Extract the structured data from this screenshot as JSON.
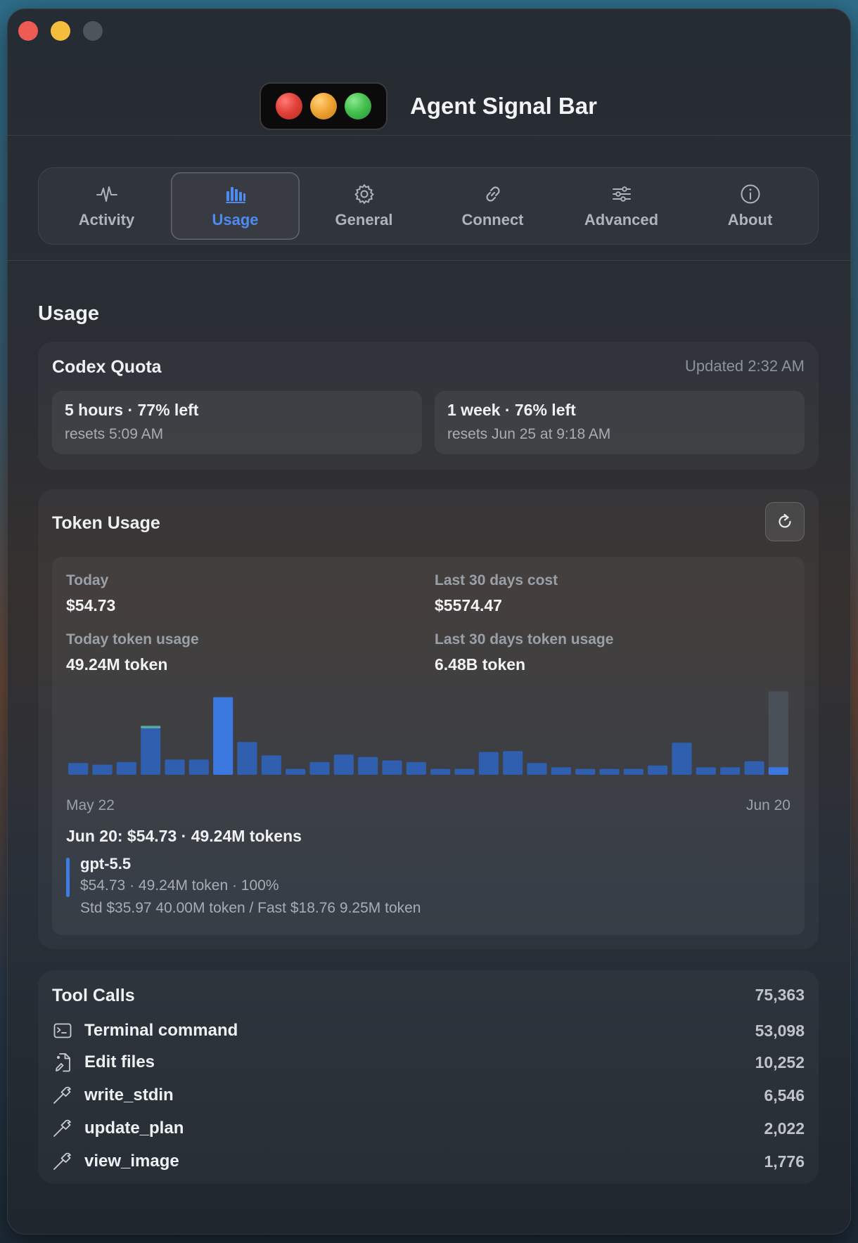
{
  "app": {
    "title": "Agent Signal Bar"
  },
  "tabs": [
    {
      "label": "Activity",
      "icon": "waveform-icon"
    },
    {
      "label": "Usage",
      "icon": "bar-chart-icon",
      "active": true
    },
    {
      "label": "General",
      "icon": "gear-icon"
    },
    {
      "label": "Connect",
      "icon": "link-icon"
    },
    {
      "label": "Advanced",
      "icon": "sliders-icon"
    },
    {
      "label": "About",
      "icon": "info-icon"
    }
  ],
  "page": {
    "title": "Usage"
  },
  "quota": {
    "title": "Codex Quota",
    "updated": "Updated 2:32 AM",
    "windows": [
      {
        "title": "5 hours · 77% left",
        "reset": "resets 5:09 AM"
      },
      {
        "title": "1 week · 76% left",
        "reset": "resets Jun 25 at 9:18 AM"
      }
    ]
  },
  "token_usage": {
    "title": "Token Usage",
    "stats": {
      "today_label": "Today",
      "today_value": "$54.73",
      "cost30_label": "Last 30 days cost",
      "cost30_value": "$5574.47",
      "today_tokens_label": "Today token usage",
      "today_tokens_value": "49.24M token",
      "tokens30_label": "Last 30 days token usage",
      "tokens30_value": "6.48B token"
    },
    "day_summary": "Jun 20: $54.73 · 49.24M tokens",
    "model": {
      "name": "gpt-5.5",
      "line1": "$54.73 · 49.24M token · 100%",
      "line2": "Std $35.97 40.00M token / Fast $18.76 9.25M token"
    }
  },
  "chart_data": {
    "type": "bar",
    "x_start_label": "May 22",
    "x_end_label": "Jun 20",
    "values": [
      14,
      12,
      15,
      55,
      18,
      18,
      92,
      39,
      23,
      7,
      15,
      24,
      21,
      17,
      15,
      7,
      7,
      27,
      28,
      14,
      9,
      7,
      7,
      7,
      11,
      38,
      9,
      9,
      16,
      9
    ],
    "accent_values": [
      0,
      0,
      0,
      3,
      0,
      0,
      0,
      0,
      0,
      0,
      0,
      0,
      0,
      0,
      0,
      0,
      0,
      0,
      0,
      0,
      0,
      0,
      0,
      0,
      0,
      0,
      0,
      0,
      0,
      0
    ],
    "selected_index": 29,
    "selected_background_value": 99,
    "ylim": [
      0,
      100
    ],
    "colors": {
      "bar": "#2f5fae",
      "peak": "#3b78e0",
      "accent": "#57a7a3",
      "selected": "#3b78e0",
      "selected_bg": "#4a5058"
    }
  },
  "tool_calls": {
    "title": "Tool Calls",
    "total": "75,363",
    "items": [
      {
        "name": "Terminal command",
        "count": "53,098",
        "icon": "terminal-icon"
      },
      {
        "name": "Edit files",
        "count": "10,252",
        "icon": "edit-file-icon"
      },
      {
        "name": "write_stdin",
        "count": "6,546",
        "icon": "hammer-icon"
      },
      {
        "name": "update_plan",
        "count": "2,022",
        "icon": "hammer-icon"
      },
      {
        "name": "view_image",
        "count": "1,776",
        "icon": "hammer-icon"
      }
    ]
  }
}
